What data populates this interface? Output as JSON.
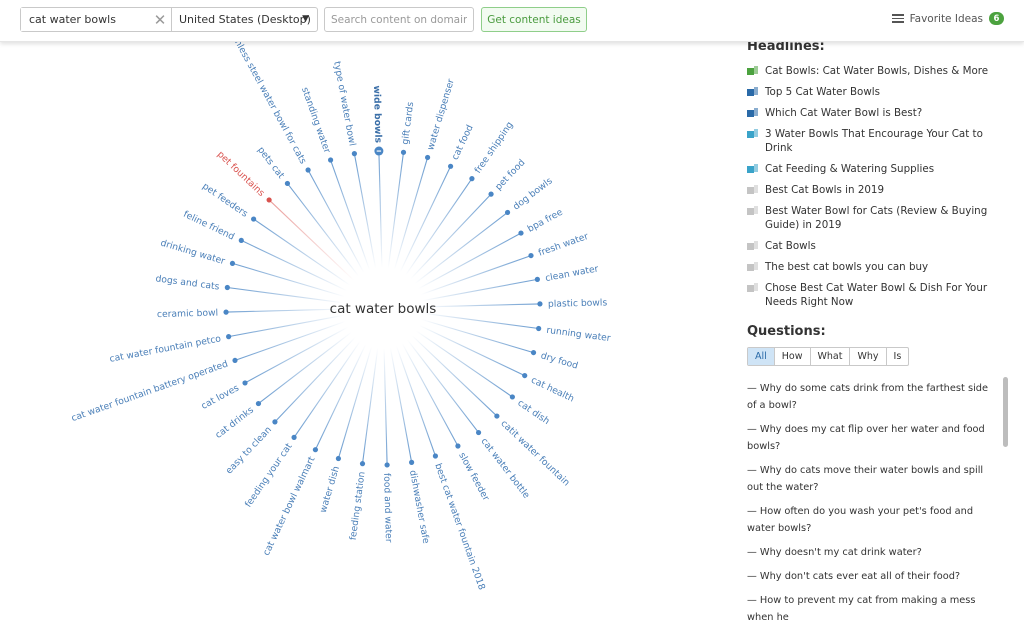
{
  "toolbar": {
    "search_value": "cat water bowls",
    "clear_icon": "close-icon",
    "country": "United States (Desktop)",
    "domain_placeholder": "Search content on domain",
    "get_ideas_label": "Get content ideas",
    "favorites_label": "Favorite Ideas",
    "favorites_count": "6"
  },
  "mindmap": {
    "center": "cat water bowls",
    "colors": {
      "spoke": "#4a86c5",
      "highlight": "#d9534f",
      "text": "#4a7fb8"
    },
    "spokes": [
      {
        "label": "stainless steel water bowl for cats"
      },
      {
        "label": "standing water"
      },
      {
        "label": "type of water bowl"
      },
      {
        "label": "wide bowls",
        "selected": true
      },
      {
        "label": "gift cards"
      },
      {
        "label": "water dispenser"
      },
      {
        "label": "cat food"
      },
      {
        "label": "free shipping"
      },
      {
        "label": "pet food"
      },
      {
        "label": "dog bowls"
      },
      {
        "label": "bpa free"
      },
      {
        "label": "fresh water"
      },
      {
        "label": "clean water"
      },
      {
        "label": "plastic bowls"
      },
      {
        "label": "running water"
      },
      {
        "label": "dry food"
      },
      {
        "label": "cat health"
      },
      {
        "label": "cat dish"
      },
      {
        "label": "catit water fountain"
      },
      {
        "label": "cat water bottle"
      },
      {
        "label": "slow feeder"
      },
      {
        "label": "best cat water fountain 2018"
      },
      {
        "label": "dishwasher safe"
      },
      {
        "label": "food and water"
      },
      {
        "label": "feeding station"
      },
      {
        "label": "water dish"
      },
      {
        "label": "cat water bowl walmart"
      },
      {
        "label": "feeding your cat"
      },
      {
        "label": "easy to clean"
      },
      {
        "label": "cat drinks"
      },
      {
        "label": "cat loves"
      },
      {
        "label": "cat water fountain battery operated"
      },
      {
        "label": "cat water fountain petco"
      },
      {
        "label": "ceramic bowl"
      },
      {
        "label": "dogs and cats"
      },
      {
        "label": "drinking water"
      },
      {
        "label": "feline friend"
      },
      {
        "label": "pet feeders"
      },
      {
        "label": "pet fountains",
        "highlighted": true
      },
      {
        "label": "pets cat"
      }
    ]
  },
  "headlines": {
    "title": "Headlines:",
    "items": [
      {
        "text": "Cat Bowls: Cat Water Bowls, Dishes & More",
        "icon": "megaphone-icon",
        "color": "#4ca23f"
      },
      {
        "text": "Top 5 Cat Water Bowls",
        "icon": "megaphone-icon",
        "color": "#2a6aa8"
      },
      {
        "text": "Which Cat Water Bowl is Best?",
        "icon": "megaphone-icon",
        "color": "#2a6aa8"
      },
      {
        "text": "3 Water Bowls That Encourage Your Cat to Drink",
        "icon": "megaphone-icon",
        "color": "#3aa3c9"
      },
      {
        "text": "Cat Feeding & Watering Supplies",
        "icon": "megaphone-icon",
        "color": "#3aa3c9"
      },
      {
        "text": "Best Cat Bowls in 2019",
        "icon": "megaphone-icon",
        "color": "#c4c4c4"
      },
      {
        "text": "Best Water Bowl for Cats (Review & Buying Guide) in 2019",
        "icon": "megaphone-icon",
        "color": "#c4c4c4"
      },
      {
        "text": "Cat Bowls",
        "icon": "megaphone-icon",
        "color": "#c4c4c4"
      },
      {
        "text": "The best cat bowls you can buy",
        "icon": "megaphone-icon",
        "color": "#c4c4c4"
      },
      {
        "text": "Chose Best Cat Water Bowl & Dish For Your Needs Right Now",
        "icon": "megaphone-icon",
        "color": "#c4c4c4"
      }
    ]
  },
  "questions": {
    "title": "Questions:",
    "tabs": [
      {
        "label": "All",
        "active": true
      },
      {
        "label": "How"
      },
      {
        "label": "What"
      },
      {
        "label": "Why"
      },
      {
        "label": "Is"
      }
    ],
    "items": [
      "— Why do some cats drink from the farthest side of a bowl?",
      "— Why does my cat flip over her water and food bowls?",
      "— Why do cats move their water bowls and spill out the water?",
      "— How often do you wash your pet's food and water bowls?",
      "— Why doesn't my cat drink water?",
      "— Why don't cats ever eat all of their food?",
      "— How to prevent my cat from making a mess when he"
    ]
  }
}
